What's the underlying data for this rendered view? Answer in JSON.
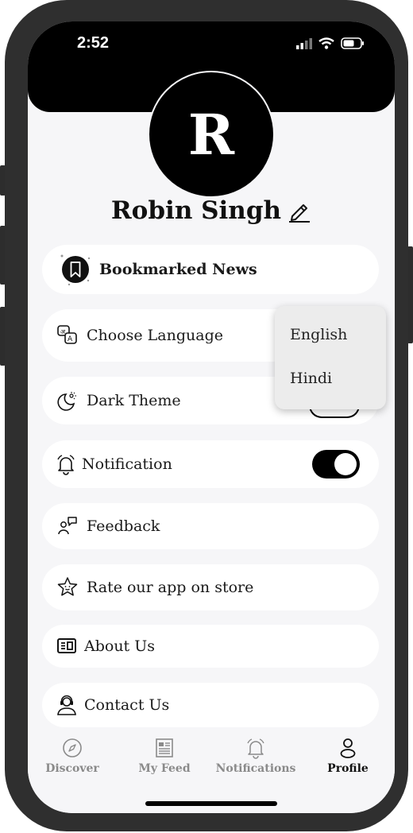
{
  "status_bar": {
    "time": "2:52"
  },
  "profile": {
    "initial": "R",
    "name": "Robin Singh"
  },
  "menu": {
    "bookmarked": "Bookmarked News",
    "language": "Choose Language",
    "dark_theme": "Dark Theme",
    "notification": "Notification",
    "notification_on": true,
    "feedback": "Feedback",
    "rate": "Rate our app on store",
    "about": "About Us",
    "contact": "Contact Us"
  },
  "language_dropdown": {
    "options": [
      "English",
      "Hindi"
    ]
  },
  "tabs": [
    {
      "label": "Discover",
      "icon": "compass-icon"
    },
    {
      "label": "My Feed",
      "icon": "newspaper-icon"
    },
    {
      "label": "Notifications",
      "icon": "bell-icon"
    },
    {
      "label": "Profile",
      "icon": "person-icon",
      "active": true
    }
  ]
}
